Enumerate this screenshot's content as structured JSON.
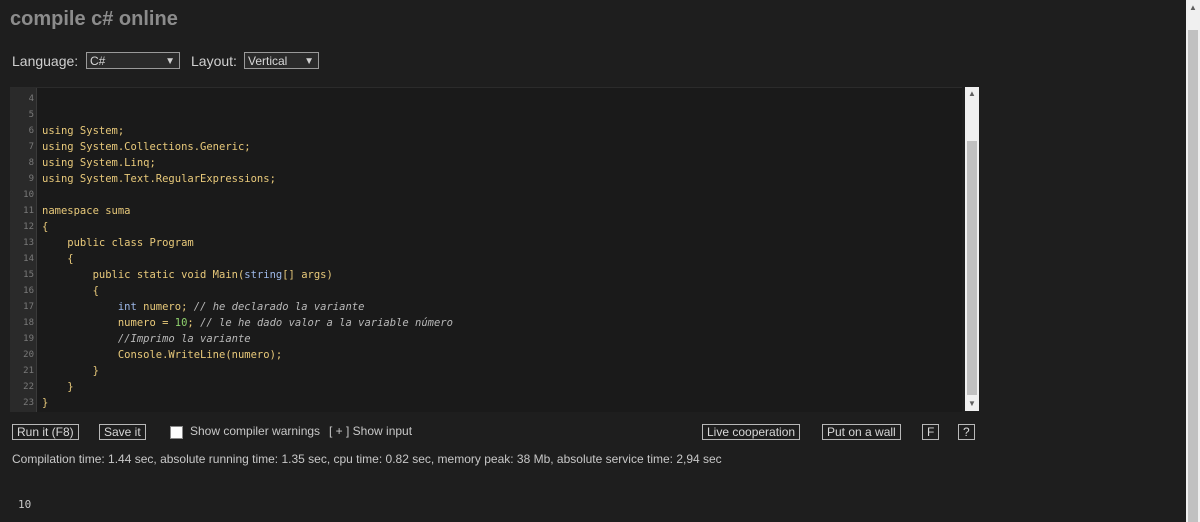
{
  "header": {
    "title": "compile c# online"
  },
  "controls": {
    "language_label": "Language:",
    "language_value": "C#",
    "layout_label": "Layout:",
    "layout_value": "Vertical"
  },
  "editor": {
    "line_numbers": [
      "4",
      "5",
      "6",
      "7",
      "8",
      "9",
      "10",
      "11",
      "12",
      "13",
      "14",
      "15",
      "16",
      "17",
      "18",
      "19",
      "20",
      "21",
      "22",
      "23"
    ],
    "lines": [
      "",
      "",
      "using System;",
      "using System.Collections.Generic;",
      "using System.Linq;",
      "using System.Text.RegularExpressions;",
      "",
      "namespace suma",
      "{",
      "    public class Program",
      "    {",
      "        public static void Main(string[] args)",
      "        {",
      "            int numero; // he declarado la variante",
      "            numero = 10; // le he dado valor a la variable número",
      "            //Imprimo la variante",
      "            Console.WriteLine(numero);",
      "        }",
      "    }",
      "}"
    ]
  },
  "toolbar": {
    "run_label": "Run it (F8)",
    "save_label": "Save it",
    "warnings_label": "Show compiler warnings",
    "show_input_label": "[ + ] Show input",
    "live_coop_label": "Live cooperation",
    "wall_label": "Put on a wall",
    "f_label": "F",
    "help_label": "?"
  },
  "status": {
    "text": "Compilation time: 1.44 sec, absolute running time: 1.35 sec, cpu time: 0.82 sec, memory peak: 38 Mb, absolute service time: 2,94 sec"
  },
  "output": {
    "text": "10"
  }
}
